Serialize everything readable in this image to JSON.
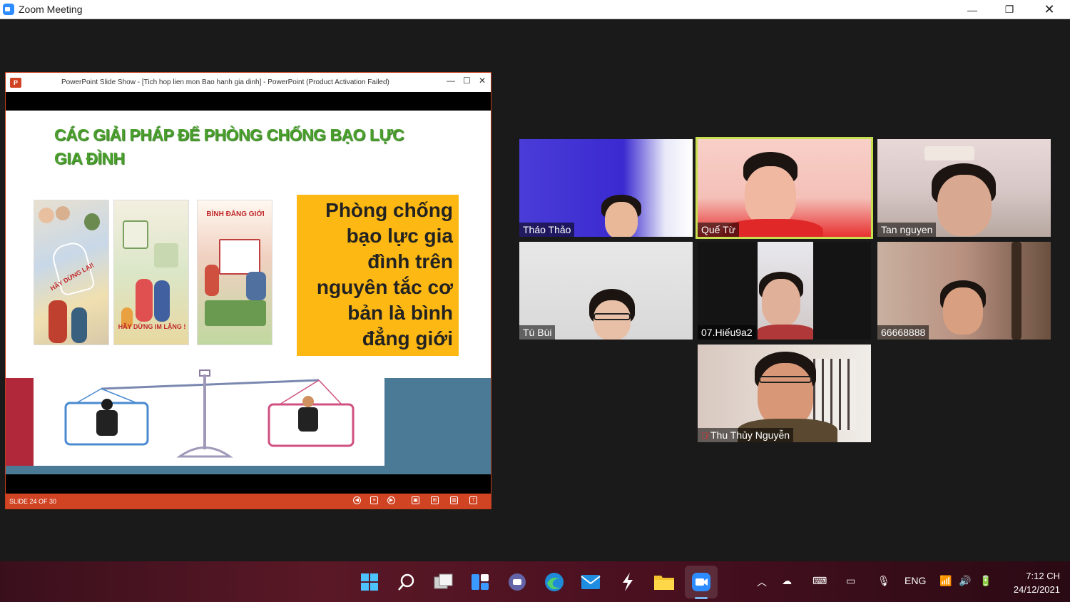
{
  "window": {
    "title": "Zoom Meeting",
    "minimize": "—",
    "maximize": "❐",
    "close": "✕"
  },
  "ppt": {
    "title": "PowerPoint Slide Show - [Tich hop lien mon  Bao hanh gia dinh] - PowerPoint (Product Activation Failed)",
    "slide_title": "CÁC GIẢI PHÁP ĐỂ PHÒNG CHỐNG BẠO LỰC GIA ĐÌNH",
    "poster1_caption": "HÃY DỪNG LẠI!",
    "poster2_caption": "HÃY DỪNG IM LẶNG !",
    "poster3_caption": "BÌNH ĐẲNG GIỚI",
    "callout_lines": [
      "Phòng chống",
      "bạo lực gia",
      "đình trên",
      "nguyên tắc cơ",
      "bản là bình",
      "đẳng giới"
    ],
    "slide_counter": "SLIDE 24 OF 30"
  },
  "participants": [
    {
      "name": "Tháo Thảo"
    },
    {
      "name": "Quế Từ"
    },
    {
      "name": "Tan nguyen"
    },
    {
      "name": "Tú Bùi"
    },
    {
      "name": "07.Hiếu9a2"
    },
    {
      "name": "66668888"
    },
    {
      "name": "Thu Thủy Nguyễn",
      "muted": true
    }
  ],
  "taskbar": {
    "icons": [
      "windows-start-icon",
      "search-icon",
      "task-view-icon",
      "widgets-icon",
      "teams-chat-icon",
      "edge-icon",
      "mail-icon",
      "app-icon",
      "file-explorer-icon",
      "zoom-icon"
    ],
    "language": "ENG",
    "time": "7:12 CH",
    "date": "24/12/2021"
  }
}
